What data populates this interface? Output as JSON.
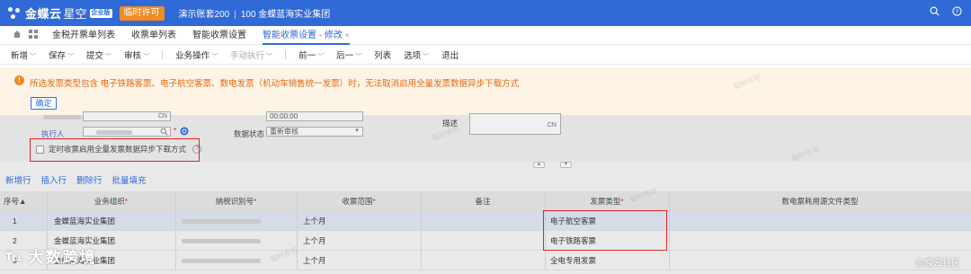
{
  "topbar": {
    "brand": "金蝶云",
    "brand_sub": "星空",
    "brand_badge": "企业版",
    "temp_license": "临时许可",
    "account_name": "演示账套200",
    "org": "100 金蝶蓝海实业集团",
    "search_icon": "search-icon",
    "help_icon": "help-circle-icon"
  },
  "tabs": [
    {
      "label": "金税开票单列表"
    },
    {
      "label": "收票单列表"
    },
    {
      "label": "智能收票设置"
    },
    {
      "label": "智能收票设置 - 修改",
      "active": true
    }
  ],
  "tab_close": "×",
  "toolbar": {
    "items": [
      {
        "label": "新增",
        "caret": true
      },
      {
        "label": "保存",
        "caret": true
      },
      {
        "label": "提交",
        "caret": true
      },
      {
        "label": "审核",
        "caret": true
      },
      {
        "label": "业务操作",
        "caret": true
      },
      {
        "label": "手动执行",
        "caret": true,
        "disabled": true
      },
      {
        "label": "前一",
        "caret": true
      },
      {
        "label": "后一",
        "caret": true
      },
      {
        "label": "列表"
      },
      {
        "label": "选项",
        "caret": true
      },
      {
        "label": "退出"
      }
    ]
  },
  "warning": {
    "icon": "!",
    "message": "所选发票类型包含 电子铁路客票、电子航空客票、数电发票（机动车销售统一发票）时，无法取消启用全量发票数据异步下载方式",
    "confirm": "确定"
  },
  "form": {
    "executor_label": "执行人",
    "data_status_label": "数据状态",
    "data_status_value": "重新审核",
    "time_value": "00:00:00",
    "remark_label": "描述",
    "cn_tag": "CN",
    "cn_tag2": "CN",
    "checkbox_label": "定时收票启用全量发票数据异步下载方式",
    "help": "?",
    "grip_up": "▲",
    "grip_down": "▼"
  },
  "entry_toolbar": [
    "新增行",
    "插入行",
    "删除行",
    "批量填充"
  ],
  "grid": {
    "columns": [
      {
        "label": "序号▲"
      },
      {
        "label": "业务组织",
        "required": true
      },
      {
        "label": "纳税识别号",
        "required": true
      },
      {
        "label": "收票范围",
        "required": true
      },
      {
        "label": "备注"
      },
      {
        "label": "发票类型",
        "required": true
      },
      {
        "label": "数电票耗用源文件类型"
      }
    ],
    "rows": [
      {
        "no": "1",
        "org": "金蝶蓝海实业集团",
        "range": "上个月",
        "invoice_type": "电子航空客票"
      },
      {
        "no": "2",
        "org": "金蝶蓝海实业集团",
        "range": "上个月",
        "invoice_type": "电子铁路客票"
      },
      {
        "no": "3",
        "org": "金蝶蓝海实业集团",
        "range": "上个月",
        "invoice_type": "全电专用发票"
      }
    ]
  },
  "watermark": "临时许可",
  "footer": {
    "left_mark": "℡",
    "left_name": "大数跨境",
    "right": "金蝶云社区"
  },
  "colors": {
    "primary": "#2f6ad6",
    "license_orange": "#f08a24",
    "warning_text": "#e06a12",
    "highlight_red": "#e02424"
  }
}
